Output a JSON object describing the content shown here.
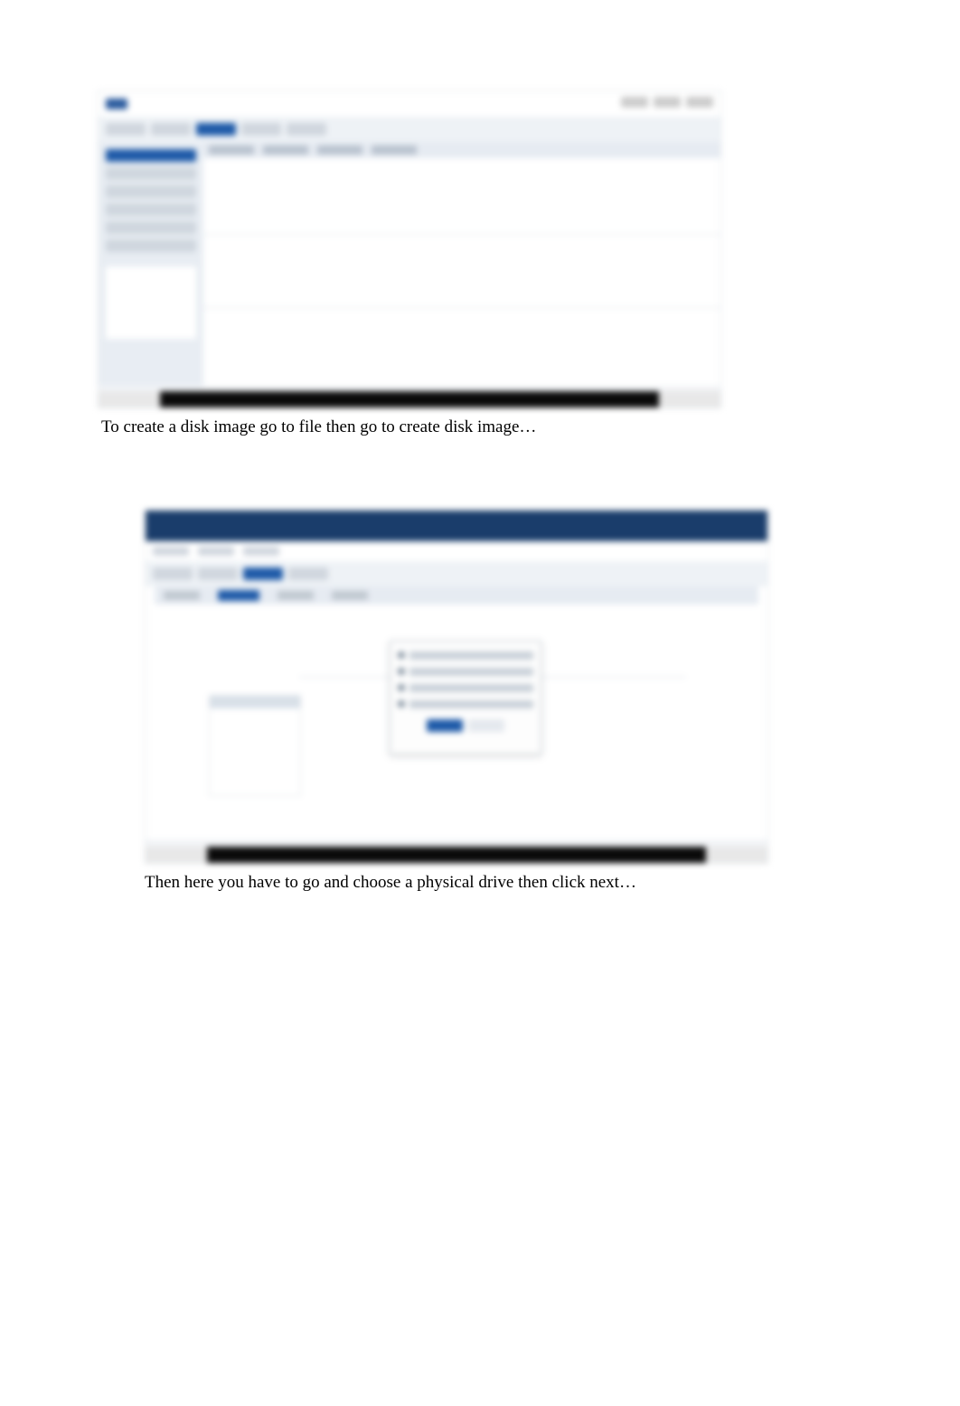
{
  "captions": {
    "caption1": "To create a disk image go to file then go to create disk image…",
    "caption2": "Then here you have to go and choose a physical drive then click next…"
  }
}
